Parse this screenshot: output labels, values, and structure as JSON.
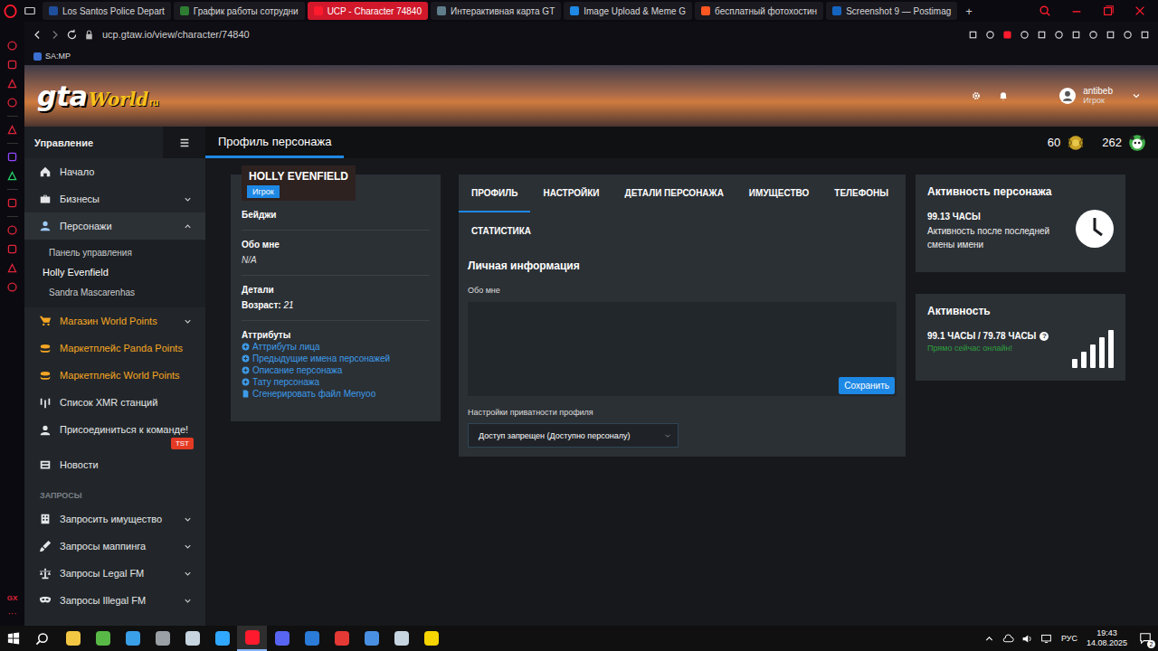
{
  "browser": {
    "tabs": [
      {
        "label": "Los Santos Police Depart",
        "selected": false
      },
      {
        "label": "График работы сотрудни",
        "selected": false
      },
      {
        "label": "UCP - Character 74840",
        "selected": true
      },
      {
        "label": "Интерактивная карта GT",
        "selected": false
      },
      {
        "label": "Image Upload & Meme G",
        "selected": false
      },
      {
        "label": "бесплатный фотохостин",
        "selected": false
      },
      {
        "label": "Screenshot 9 — Postimag",
        "selected": false
      }
    ],
    "new_tab": "+",
    "url": "ucp.gtaw.io/view/character/74840",
    "bookmarks": [
      "SA:MP"
    ],
    "sidebar_footer": [
      "GX",
      "···"
    ]
  },
  "site": {
    "logo": {
      "main": "gta",
      "script": "World",
      "suffix": "ru"
    },
    "user": {
      "name": "antibeb",
      "role": "Игрок"
    },
    "page_title": "Профиль персонажа",
    "currencies": [
      {
        "value": "60",
        "kind": "world"
      },
      {
        "value": "262",
        "kind": "panda"
      }
    ],
    "sidebar": {
      "title": "Управление",
      "items": [
        {
          "label": "Начало",
          "color": "#e4e6e8",
          "submenu": false,
          "expanded": false,
          "selected": false
        },
        {
          "label": "Бизнесы",
          "color": "#e4e6e8",
          "submenu": true,
          "expanded": false,
          "selected": false
        },
        {
          "label": "Персонажи",
          "color": "#e4e6e8",
          "submenu": true,
          "expanded": true,
          "selected": true,
          "children": [
            {
              "label": "Панель управления",
              "selected": false
            },
            {
              "label": "Holly Evenfield",
              "selected": true
            },
            {
              "label": "Sandra Mascarenhas",
              "selected": false
            }
          ]
        },
        {
          "label": "Магазин World Points",
          "color": "#f5a623",
          "submenu": true,
          "expanded": false,
          "selected": false
        },
        {
          "label": "Маркетплейс Panda Points",
          "color": "#f5a623",
          "submenu": false,
          "expanded": false,
          "selected": false
        },
        {
          "label": "Маркетплейс World Points",
          "color": "#f5a623",
          "submenu": false,
          "expanded": false,
          "selected": false
        },
        {
          "label": "Список XMR станций",
          "color": "#e4e6e8",
          "submenu": false,
          "expanded": false,
          "selected": false
        },
        {
          "label": "Присоединиться к команде!",
          "color": "#e4e6e8",
          "submenu": false,
          "expanded": false,
          "selected": false,
          "badge": "TST"
        },
        {
          "label": "Новости",
          "color": "#e4e6e8",
          "submenu": false,
          "expanded": false,
          "selected": false
        }
      ],
      "section_title": "ЗАПРОСЫ",
      "requests": [
        {
          "label": "Запросить имущество",
          "color": "#e4e6e8",
          "submenu": true,
          "expanded": false,
          "selected": false
        },
        {
          "label": "Запросы маппинга",
          "color": "#e4e6e8",
          "submenu": true,
          "expanded": false,
          "selected": false
        },
        {
          "label": "Запросы Legal FM",
          "color": "#e4e6e8",
          "submenu": true,
          "expanded": false,
          "selected": false
        },
        {
          "label": "Запросы Illegal FM",
          "color": "#e4e6e8",
          "submenu": true,
          "expanded": false,
          "selected": false
        }
      ]
    },
    "character_card": {
      "name": "HOLLY EVENFIELD",
      "role": "Игрок",
      "badges_title": "Бейджи",
      "about_title": "Обо мне",
      "about_value": "N/A",
      "details_title": "Детали",
      "age_label": "Возраст:",
      "age_value": "21",
      "attributes_title": "Аттрибуты",
      "links": [
        {
          "label": "Аттрибуты лица",
          "kind": "toggle"
        },
        {
          "label": "Предыдущие имена персонажей",
          "kind": "toggle"
        },
        {
          "label": "Описание персонажа",
          "kind": "toggle"
        },
        {
          "label": "Тату персонажа",
          "kind": "toggle"
        },
        {
          "label": "Сгенерировать файл Menyoo",
          "kind": "file"
        }
      ]
    },
    "profile": {
      "tabs": [
        {
          "label": "ПРОФИЛЬ",
          "selected": true
        },
        {
          "label": "НАСТРОЙКИ",
          "selected": false
        },
        {
          "label": "ДЕТАЛИ ПЕРСОНАЖА",
          "selected": false
        },
        {
          "label": "ИМУЩЕСТВО",
          "selected": false
        },
        {
          "label": "ТЕЛЕФОНЫ",
          "selected": false
        },
        {
          "label": "СТАТИСТИКА",
          "selected": false
        }
      ],
      "section_title": "Личная информация",
      "about_label": "Обо мне",
      "about_value": "",
      "save_button": "Сохранить",
      "privacy_label": "Настройки приватности профиля",
      "privacy_value": "Доступ запрещен (Доступно персоналу)"
    },
    "activity_character": {
      "title": "Активность персонажа",
      "hours": "99.13 ЧАСЫ",
      "description": "Активность после последней смены имени"
    },
    "activity": {
      "title": "Активность",
      "hours": "99.1 ЧАСЫ / 79.78 ЧАСЫ",
      "help": "?",
      "status": "Прямо сейчас онлайн!",
      "level": 1
    }
  },
  "taskbar": {
    "apps": [
      {
        "selected": false
      },
      {
        "selected": false
      },
      {
        "selected": false
      },
      {
        "selected": false
      },
      {
        "selected": false
      },
      {
        "selected": false
      },
      {
        "selected": true
      },
      {
        "selected": false
      },
      {
        "selected": false
      },
      {
        "selected": false
      },
      {
        "selected": false
      },
      {
        "selected": false
      },
      {
        "selected": false
      }
    ],
    "language": "РУС",
    "time": "19:43",
    "date": "14.08.2025",
    "notifications": "2"
  }
}
